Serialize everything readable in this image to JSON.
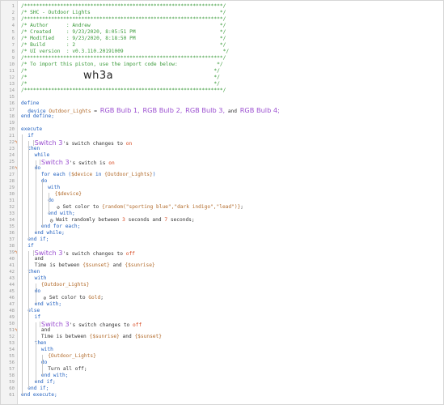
{
  "header": {
    "stars": "/******************************************************************/",
    "title_line": "/* SHC - Outdoor Lights                                           */",
    "author": "/* Author      : Andrew                                           */",
    "created": "/* Created     : 9/23/2020, 8:05:51 PM                            */",
    "modified": "/* Modified    : 9/23/2020, 8:18:50 PM                            */",
    "build": "/* Build       : 2                                                */",
    "ui": "/* UI version  : v0.3.110.20191009                                 */",
    "import": "/* To import this piston, use the import code below:             */",
    "blank1": "/*                                                              */",
    "blank2": "/*                                                              */",
    "blank3": "/*                                                              */",
    "code": "wh3a"
  },
  "line_numbers": [
    "1",
    "2",
    "3",
    "4",
    "5",
    "6",
    "7",
    "8",
    "9",
    "10",
    "11",
    "12",
    "13",
    "14",
    "15",
    "16",
    "17",
    "18",
    "19",
    "20",
    "21",
    "22",
    "23",
    "24",
    "25",
    "26",
    "27",
    "28",
    "29",
    "30",
    "31",
    "32",
    "33",
    "34",
    "35",
    "36",
    "37",
    "38",
    "39",
    "40",
    "41",
    "42",
    "43",
    "44",
    "45",
    "46",
    "47",
    "48",
    "49",
    "50",
    "51",
    "52",
    "53",
    "54",
    "55",
    "56",
    "57",
    "58",
    "59",
    "60",
    "61"
  ],
  "trigger_marks": {
    "22": "ϟ",
    "26": "ϟ",
    "39": "ϟ",
    "51": "ϟ"
  },
  "define": {
    "kw": "define",
    "device_kw": "device",
    "var": "Outdoor_Lights",
    "eq": "=",
    "bulb1": "RGB Bulb 1,",
    "bulb2": "RGB Bulb 2,",
    "bulb3": "RGB Bulb 3,",
    "and": "and",
    "bulb4": "RGB Bulb 4;",
    "end": "end define;"
  },
  "execute": {
    "kw": "execute",
    "if1": "if",
    "sw3a": "Switch 3",
    "sw3a_tail": "'s switch changes to",
    "on1": "on",
    "then1": "then",
    "while": "while",
    "sw3b": "Switch 3",
    "sw3b_tail": "'s switch is",
    "on2": "on",
    "do1": "do",
    "foreach_a": "for each (",
    "foreach_b": "$device",
    "foreach_c": "in",
    "foreach_d": "{Outdoor_Lights}",
    "foreach_e": ")",
    "do2": "do",
    "with1": "with",
    "dev_ref": "{$device}",
    "do3": "do",
    "setcolor_a": "Set color to",
    "setcolor_b": "{random(\"sporting blue\",\"dark indigo\",\"lead\")}",
    "setcolor_c": ";",
    "endwith1": "end with;",
    "wait_a": "Wait randomly between",
    "wait_b": "3",
    "wait_c": "seconds and",
    "wait_d": "7",
    "wait_e": "seconds;",
    "endfor": "end for each;",
    "endwhile": "end while;",
    "endif1": "end if;",
    "if2": "if",
    "sw3c": "Switch 3",
    "sw3c_tail": "'s switch changes to",
    "off1": "off",
    "and1": "and",
    "time1_a": "Time is between",
    "time1_b": "{$sunset}",
    "time1_c": "and",
    "time1_d": "{$sunrise}",
    "then2": "then",
    "with2": "with",
    "ol_ref1": "{Outdoor_Lights}",
    "do4": "do",
    "gold_a": "Set color to",
    "gold_b": "Gold",
    "gold_c": ";",
    "endwith2": "end with;",
    "else": "else",
    "if3": "if",
    "sw3d": "Switch 3",
    "sw3d_tail": "'s switch changes to",
    "off2": "off",
    "and2": "and",
    "time2_a": "Time is between",
    "time2_b": "{$sunrise}",
    "time2_c": "and",
    "time2_d": "{$sunset}",
    "then3": "then",
    "with3": "with",
    "ol_ref2": "{Outdoor_Lights}",
    "do5": "do",
    "turnoff": "Turn all off;",
    "endwith3": "end with;",
    "endif3": "end if;",
    "endif2": "end if;",
    "end": "end execute;"
  },
  "icons": {
    "task": "paint-drop-icon",
    "wait": "clock-icon"
  },
  "colors": {
    "keyword": "#1f5fbf",
    "comment": "#3a9a3a",
    "device": "#9b4fd0",
    "value": "#b26b2b",
    "literal": "#d7481f"
  }
}
